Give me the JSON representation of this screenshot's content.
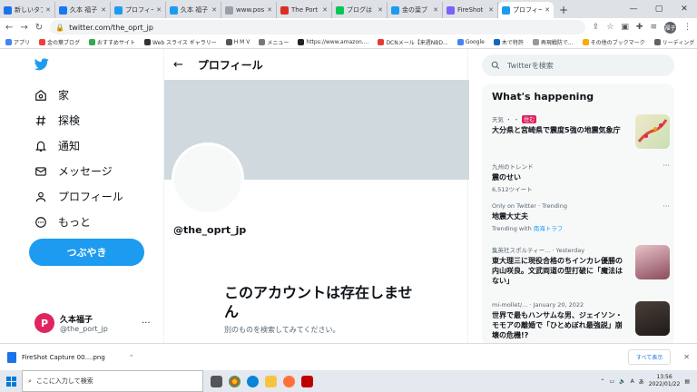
{
  "tabs": [
    {
      "label": "新しいタブ",
      "color": "#1a73e8"
    },
    {
      "label": "久本 福子",
      "color": "#1877f2"
    },
    {
      "label": "プロフィー",
      "color": "#1d9bf0"
    },
    {
      "label": "久本 福子",
      "color": "#1d9bf0"
    },
    {
      "label": "www.pos",
      "color": "#9aa0a6"
    },
    {
      "label": "The Port",
      "color": "#d93025"
    },
    {
      "label": "ブログは",
      "color": "#06c755"
    },
    {
      "label": "金の葉ブ",
      "color": "#1d9bf0"
    },
    {
      "label": "FireShot",
      "color": "#7b61ff"
    },
    {
      "label": "プロフィー",
      "color": "#1d9bf0",
      "active": true
    }
  ],
  "url": "twitter.com/the_oprt_jp",
  "bookmarks": [
    "アプリ",
    "金の葉ブログ",
    "おすすめサイト",
    "Web スライス ギャラリー",
    "H M V",
    "メニュー",
    "https://www.amazon....",
    "DCNメール【来週NBD...",
    "Google",
    "木で特許",
    "再現戦防で..."
  ],
  "bookmarks_right": [
    "その他のブックマーク",
    "リーディング リスト"
  ],
  "profile_initials": "福子",
  "nav": {
    "home": "家",
    "explore": "探検",
    "notifications": "通知",
    "messages": "メッセージ",
    "profile": "プロフィール",
    "more": "もっと",
    "tweet": "つぶやき"
  },
  "account": {
    "name": "久本福子",
    "handle": "@the_port_jp",
    "more": "···",
    "avatar_letter": "P"
  },
  "main": {
    "header_title": "プロフィール",
    "handle": "@the_oprt_jp",
    "not_exist": "このアカウントは存在しません",
    "not_exist_sub": "別のものを検索してみてください。"
  },
  "sidebar": {
    "search_placeholder": "Twitterを検索",
    "heading": "What's happening",
    "trends": [
      {
        "meta": "天気 ・ ・",
        "badge": "住む",
        "title": "大分県と宮崎県で震度5強の地震気象庁",
        "sub": ""
      },
      {
        "meta": "九州のトレンド",
        "title": "震のせい",
        "sub": "6,512ツイート"
      },
      {
        "meta": "Only on Twitter · Trending",
        "title": "地震大丈夫",
        "sub_prefix": "Trending with",
        "sub_link": "南海トラフ"
      },
      {
        "meta": "集英社スポルティー... · Yesterday",
        "title": "東大理三に現役合格のちインカレ優勝の内山咲良。文武両道の型打破に「魔法はない」",
        "sub": ""
      },
      {
        "meta": "mi-mollet/... · January 20, 2022",
        "title": "世界で最もハンサムな男、ジェイソン・モモアの離婚で「ひとめぼれ最強説」崩壊の危機!?",
        "sub": ""
      }
    ],
    "more": "···"
  },
  "download": {
    "file": "FireShot Capture 00....png",
    "show_all": "すべて表示"
  },
  "taskbar": {
    "search": "ここに入力して検索",
    "time": "13:56",
    "date": "2022/01/22",
    "lang": "A",
    "weather": "あ"
  }
}
